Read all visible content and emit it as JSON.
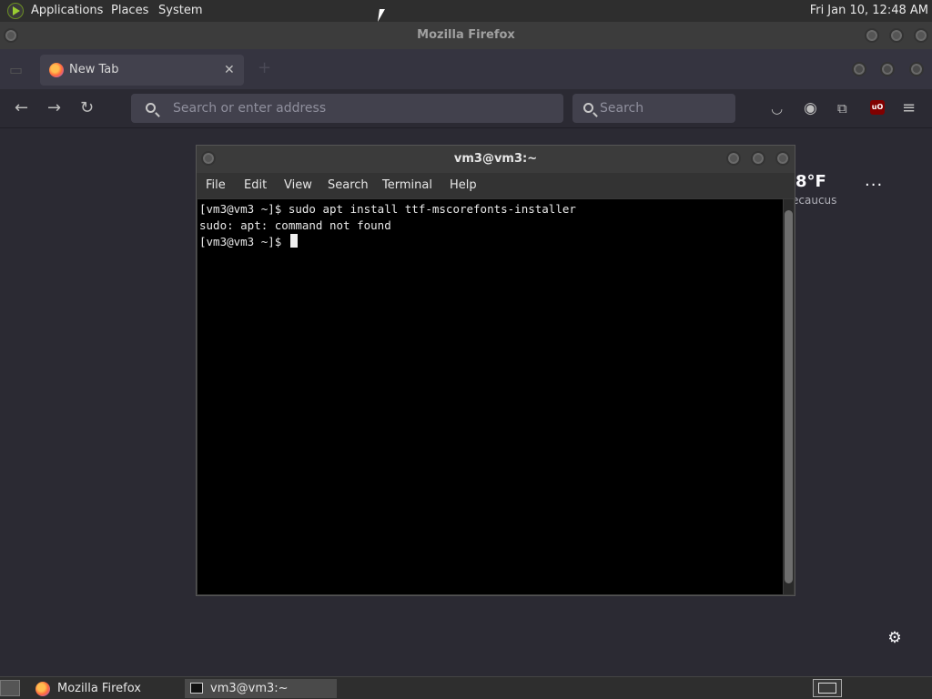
{
  "top_panel": {
    "menus": [
      "Applications",
      "Places",
      "System"
    ],
    "clock": "Fri Jan 10, 12:48 AM"
  },
  "firefox": {
    "window_title": "Mozilla Firefox",
    "tab": {
      "label": "New Tab"
    },
    "urlbar_placeholder": "Search or enter address",
    "searchbar_placeholder": "Search",
    "weather": {
      "temp": "8°F",
      "city": "ecaucus"
    }
  },
  "terminal": {
    "title": "vm3@vm3:~",
    "menu": [
      "File",
      "Edit",
      "View",
      "Search",
      "Terminal",
      "Help"
    ],
    "lines": [
      "[vm3@vm3 ~]$ sudo apt install ttf-mscorefonts-installer",
      "sudo: apt: command not found",
      "[vm3@vm3 ~]$ "
    ]
  },
  "taskbar": {
    "tasks": [
      "Mozilla Firefox",
      "vm3@vm3:~"
    ]
  },
  "colors": {
    "firefox_bg": "#2b2a33",
    "panel_bg": "#2e2e2e",
    "terminal_bg": "#000000",
    "accent_orange": "#ff6a3d"
  }
}
